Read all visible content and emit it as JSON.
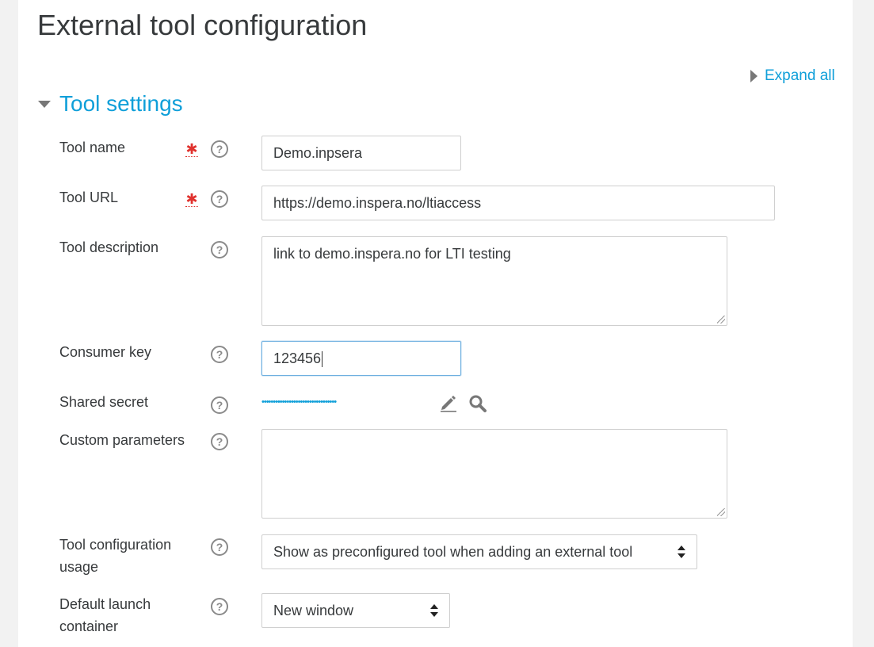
{
  "page_title": "External tool configuration",
  "expand_all": "Expand all",
  "section": {
    "legend": "Tool settings"
  },
  "fields": {
    "tool_name": {
      "label": "Tool name",
      "value": "Demo.inpsera"
    },
    "tool_url": {
      "label": "Tool URL",
      "value": "https://demo.inspera.no/ltiaccess"
    },
    "tool_description": {
      "label": "Tool description",
      "value": "link to demo.inspera.no for LTI testing"
    },
    "consumer_key": {
      "label": "Consumer key",
      "value": "123456"
    },
    "shared_secret": {
      "label": "Shared secret",
      "masked": "•••••••••••••••••••••••••••••••••"
    },
    "custom_parameters": {
      "label": "Custom parameters",
      "value": ""
    },
    "tool_configuration_usage": {
      "label": "Tool configuration usage",
      "selected": "Show as preconfigured tool when adding an external tool"
    },
    "default_launch_container": {
      "label": "Default launch container",
      "selected": "New window"
    }
  },
  "icons": {
    "required": "required-asterisk-icon",
    "help": "help-question-icon",
    "edit": "pencil-icon",
    "reveal": "magnifier-icon"
  },
  "colors": {
    "accent": "#0f9fd9",
    "required": "#e0332f",
    "focus_border": "#6fb0e0"
  }
}
